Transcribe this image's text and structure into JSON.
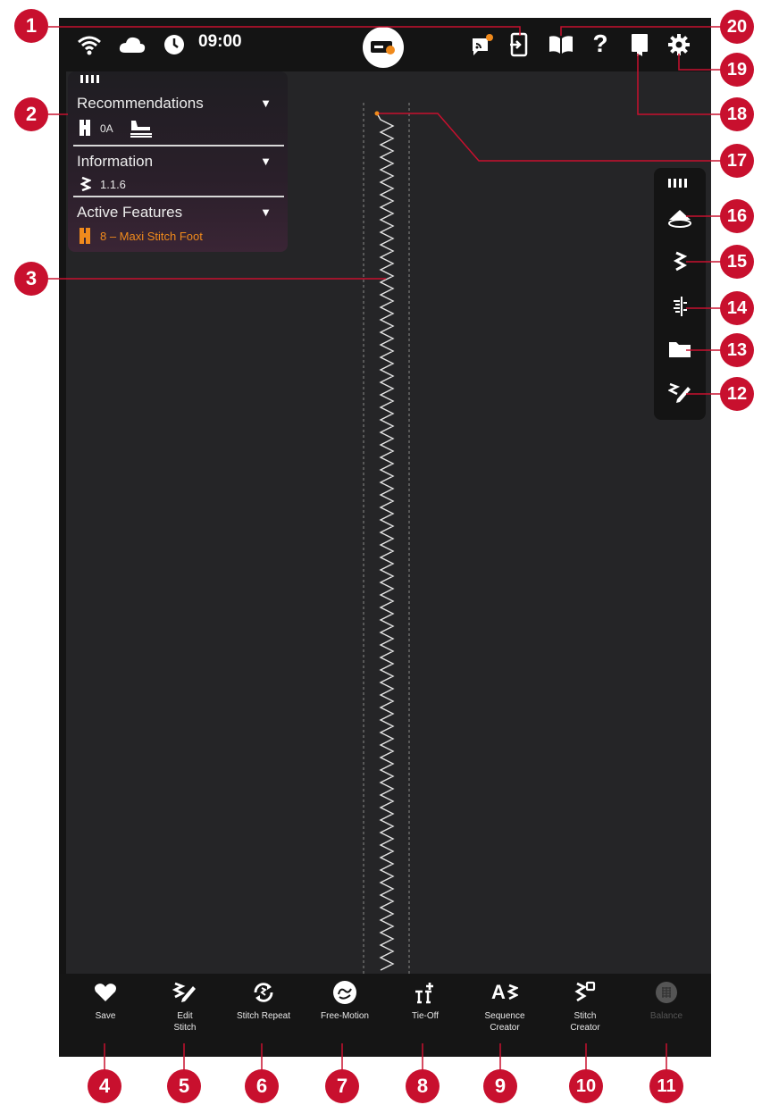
{
  "status_bar": {
    "time": "09:00",
    "icons": [
      "wifi-icon",
      "cloud-icon",
      "clock-icon",
      "sewing-mode-icon",
      "notification-icon",
      "device-import-icon",
      "manual-icon",
      "help-icon",
      "quickhelp-icon",
      "settings-icon"
    ]
  },
  "info_panel": {
    "recommendations": {
      "title": "Recommendations",
      "foot": "0A"
    },
    "information": {
      "title": "Information",
      "stitch_number": "1.1.6"
    },
    "active_features": {
      "title": "Active Features",
      "feature": "8 – Maxi Stitch Foot"
    }
  },
  "right_toolbar": {
    "icons": [
      "bobbin-icon",
      "stitch-settings-icon",
      "stitch-positioning-icon",
      "folder-icon",
      "edit-pen-icon"
    ]
  },
  "bottom_bar": {
    "items": [
      {
        "label": "Save",
        "icon": "heart-icon"
      },
      {
        "label": "Edit\nStitch",
        "icon": "edit-stitch-icon"
      },
      {
        "label": "Stitch Repeat",
        "icon": "stitch-repeat-icon"
      },
      {
        "label": "Free-Motion",
        "icon": "free-motion-icon"
      },
      {
        "label": "Tie-Off",
        "icon": "tie-off-icon"
      },
      {
        "label": "Sequence\nCreator",
        "icon": "sequence-creator-icon",
        "glyph": "A"
      },
      {
        "label": "Stitch\nCreator",
        "icon": "stitch-creator-icon"
      },
      {
        "label": "Balance",
        "icon": "balance-icon",
        "disabled": true
      }
    ]
  },
  "callouts": [
    "1",
    "2",
    "3",
    "4",
    "5",
    "6",
    "7",
    "8",
    "9",
    "10",
    "11",
    "12",
    "13",
    "14",
    "15",
    "16",
    "17",
    "18",
    "19",
    "20"
  ],
  "colors": {
    "callout": "#c8102e",
    "accent": "#f08a1c",
    "screen": "#252527",
    "bar": "#141414"
  }
}
